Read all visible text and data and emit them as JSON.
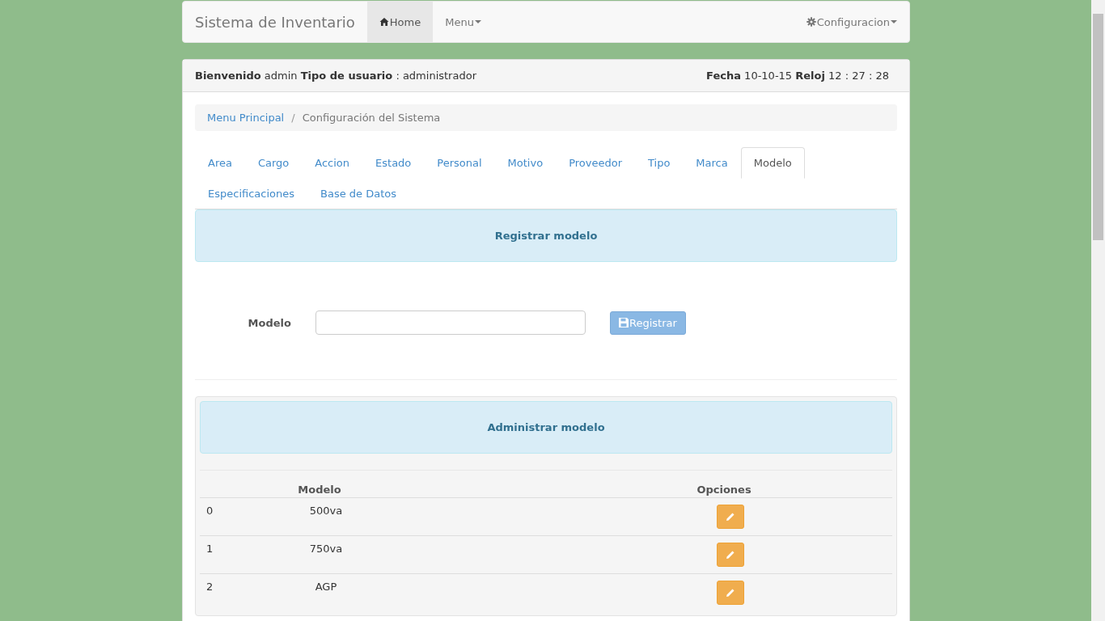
{
  "navbar": {
    "brand": "Sistema de Inventario",
    "items": [
      {
        "label": "Home",
        "dropdown": false,
        "selected": true
      },
      {
        "label": "Menu",
        "dropdown": true,
        "selected": false
      }
    ],
    "right_item": {
      "label": "Configuracion",
      "dropdown": true
    }
  },
  "header": {
    "welcome": "**Bienvenido** admin **Tipo de usuario** : administrador",
    "clock": "**Fecha** 10-10-15 **Reloj** 12 : 27 : 28"
  },
  "breadcrumb_separator": "/",
  "breadcrumb": [
    {
      "label": "Menu Principal",
      "kind": "link"
    },
    {
      "label": "Configuración del Sistema",
      "kind": "current"
    }
  ],
  "tabs": [
    {
      "label": "Area",
      "selected": false
    },
    {
      "label": "Cargo",
      "selected": false
    },
    {
      "label": "Accion",
      "selected": false
    },
    {
      "label": "Estado",
      "selected": false
    },
    {
      "label": "Personal",
      "selected": false
    },
    {
      "label": "Motivo",
      "selected": false
    },
    {
      "label": "Proveedor",
      "selected": false
    },
    {
      "label": "Tipo",
      "selected": false
    },
    {
      "label": "Marca",
      "selected": false
    },
    {
      "label": "Modelo",
      "selected": true
    },
    {
      "label": "Especificaciones",
      "selected": false
    },
    {
      "label": "Base de Datos",
      "selected": false
    }
  ],
  "register": {
    "title": "Registrar modelo",
    "field_label": "Modelo",
    "button": "Registrar"
  },
  "admin": {
    "title": "Administrar modelo",
    "columns": [
      "Modelo",
      "Opciones"
    ],
    "rows": [
      {
        "index": "0",
        "name": "500va"
      },
      {
        "index": "1",
        "name": "750va"
      },
      {
        "index": "2",
        "name": "AGP"
      }
    ]
  }
}
